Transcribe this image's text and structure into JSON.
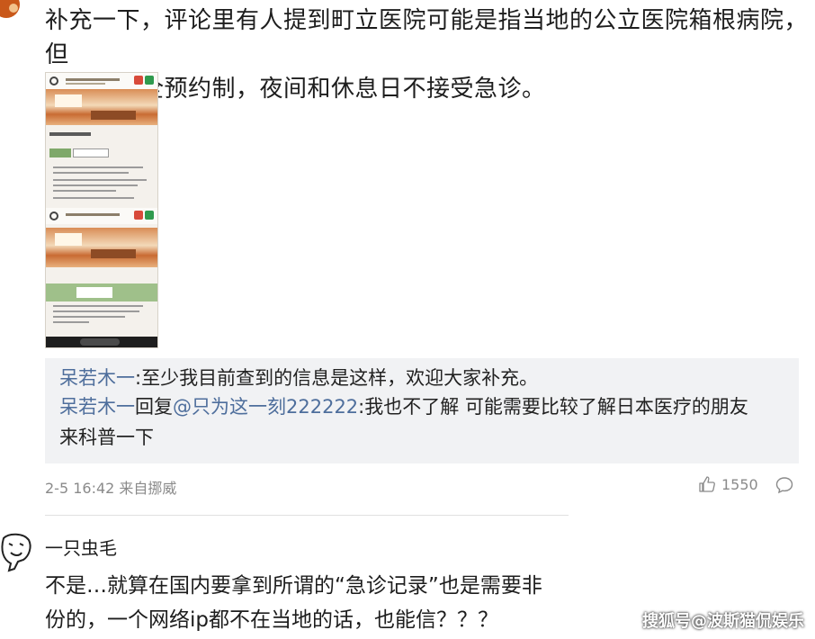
{
  "post": {
    "text_line1": "补充一下，评论里有人提到町立医院可能是指当地的公立医院箱根病院，但",
    "text_line2": "这家医院全预约制，夜间和休息日不接受急诊。"
  },
  "replies": [
    {
      "name": "呆若木一",
      "text": ":至少我目前查到的信息是这样，欢迎大家补充。"
    },
    {
      "name": "呆若木一",
      "connector": "回复",
      "mention": "@只为这一刻222222",
      "text": ":我也不了解 可能需要比较了解日本医疗的朋友",
      "text_cont": "来科普一下"
    }
  ],
  "meta": {
    "timestamp": "2-5 16:42",
    "source": "来自挪威",
    "like_count": "1550",
    "like_icon": "thumbs-up-icon",
    "reply_icon": "comment-bubble-icon"
  },
  "comment2": {
    "username": "一只虫毛",
    "line1": "不是…就算在国内要拿到所谓的“急诊记录”也是需要非",
    "line2": "份的，一个网络ip都不在当地的话，也能信？？？"
  },
  "watermark": "搜狐号@波斯猫侃娱乐",
  "colors": {
    "link": "#4e6e9c",
    "reply_bg": "#f1f2f4",
    "meta": "#8a8a8a"
  }
}
